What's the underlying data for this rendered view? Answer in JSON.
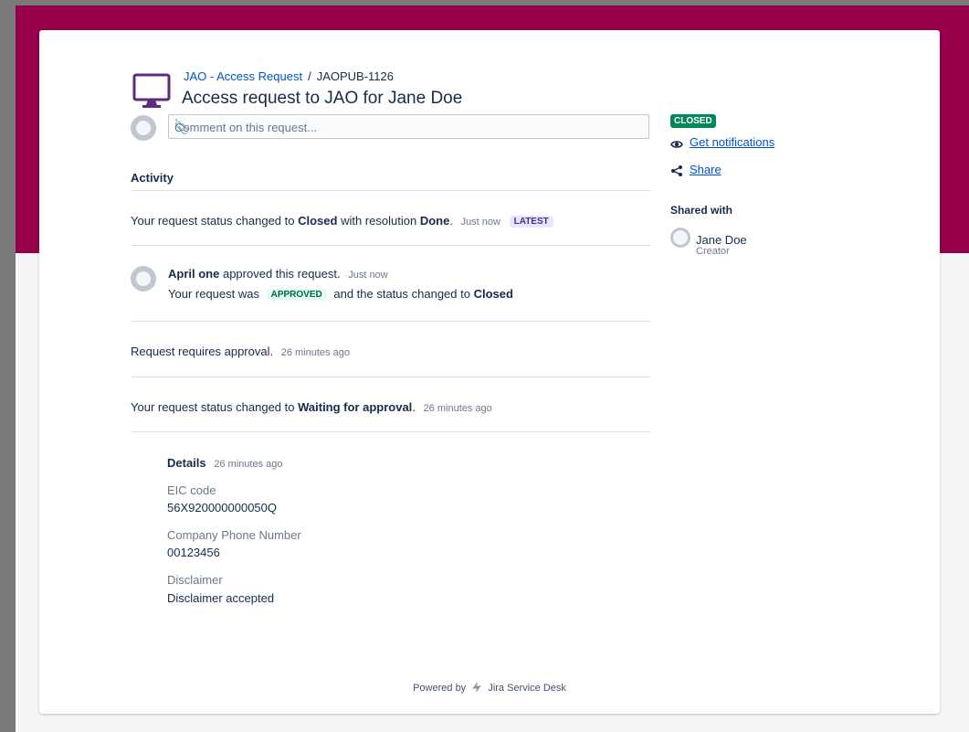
{
  "breadcrumb": {
    "project": "JAO - Access Request",
    "separator": "/",
    "issue_key": "JAOPUB-1126"
  },
  "request": {
    "title": "Access request to JAO for Jane Doe",
    "status": "CLOSED"
  },
  "comment": {
    "placeholder": "Comment on this request..."
  },
  "activity": {
    "heading": "Activity",
    "items": [
      {
        "prefix": "Your request status changed to",
        "status": "Closed",
        "middle": "with resolution",
        "resolution": "Done",
        "suffix": ".",
        "timestamp": "Just now",
        "badge": "LATEST"
      },
      {
        "actor": "April one",
        "action": "approved this request.",
        "timestamp": "Just now",
        "detail_prefix": "Your request was",
        "detail_badge": "APPROVED",
        "detail_middle": "and the status changed to",
        "detail_status": "Closed"
      },
      {
        "text": "Request requires approval.",
        "timestamp": "26 minutes ago"
      },
      {
        "prefix": "Your request status changed to",
        "status": "Waiting for approval",
        "suffix": ".",
        "timestamp": "26 minutes ago"
      }
    ],
    "details": {
      "heading": "Details",
      "timestamp": "26 minutes ago",
      "fields": [
        {
          "label": "EIC code",
          "value": "56X920000000050Q"
        },
        {
          "label": "Company Phone Number",
          "value": "00123456"
        },
        {
          "label": "Disclaimer",
          "value": "Disclaimer accepted"
        }
      ]
    }
  },
  "sidebar": {
    "notifications_label": "Get notifications",
    "share_label": "Share",
    "shared_with_heading": "Shared with",
    "participant": {
      "name": "Jane Doe",
      "role": "Creator"
    }
  },
  "footer": {
    "powered_by": "Powered by",
    "product": "Jira Service Desk"
  },
  "colors": {
    "banner": "#960049",
    "status_closed": "#00875a",
    "link": "#0052cc",
    "portal_icon": "#5e2a84"
  }
}
